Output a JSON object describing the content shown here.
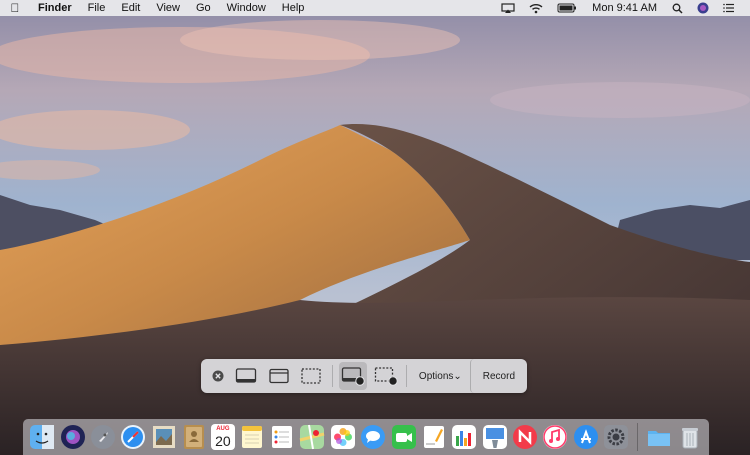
{
  "menubar": {
    "app_name": "Finder",
    "menus": [
      "File",
      "Edit",
      "View",
      "Go",
      "Window",
      "Help"
    ],
    "clock": "Mon 9:41 AM"
  },
  "toolbar": {
    "options_label": "Options⌄",
    "record_label": "Record"
  },
  "dock": {
    "calendar_month": "AUG",
    "calendar_day": "20"
  }
}
